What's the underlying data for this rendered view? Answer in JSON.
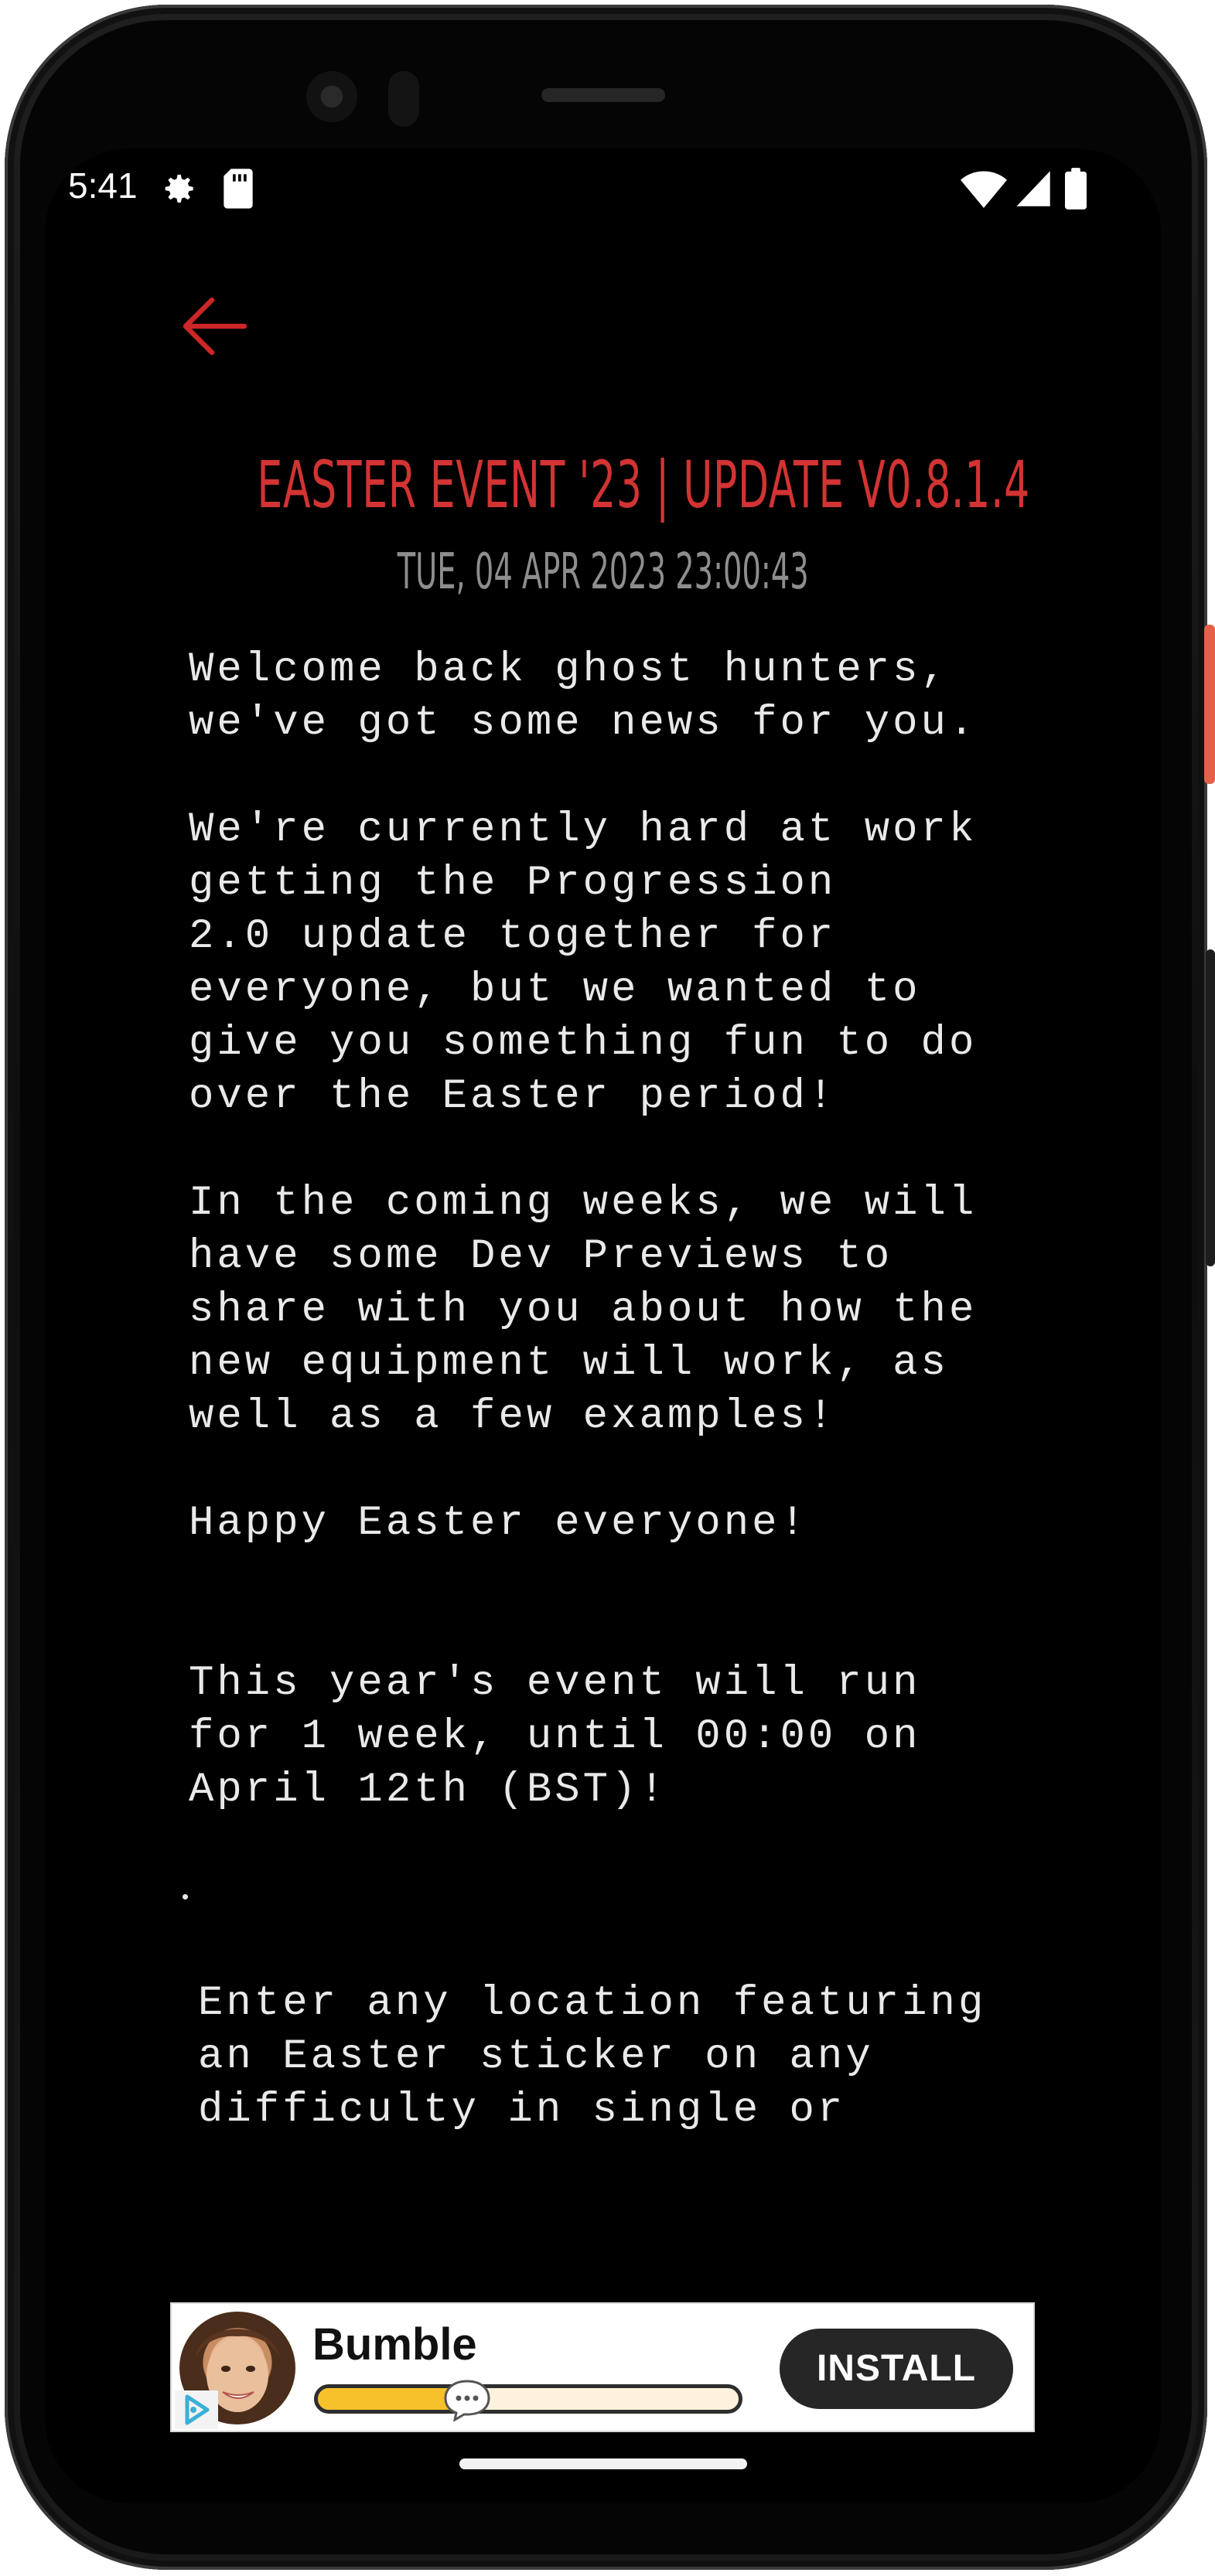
{
  "status_bar": {
    "time": "5:41",
    "icons": [
      "settings-gear-icon",
      "sd-card-icon",
      "wifi-icon",
      "cell-signal-icon",
      "battery-icon"
    ]
  },
  "header": {
    "back_icon": "arrow-left-icon",
    "title": "EASTER EVENT '23 | UPDATE V0.8.1.4",
    "date": "TUE, 04 APR 2023 23:00:43"
  },
  "article": {
    "paragraphs": [
      "Welcome back ghost hunters,\nwe've got some news for you.",
      "We're currently hard at work\ngetting the Progression\n2.0 update together for\neveryone, but we wanted to\ngive you something fun to do\nover the Easter period!",
      "In the coming weeks, we will\nhave some Dev Previews to\nshare with you about how the\nnew equipment will work, as\nwell as a few examples!",
      "Happy Easter everyone!",
      "This year's event will run\nfor 1 week, until 00:00 on\nApril 12th (BST)!"
    ],
    "bullet": "Enter any location featuring\nan Easter sticker on any\ndifficulty in single or"
  },
  "ad": {
    "app_name": "Bumble",
    "install_label": "INSTALL",
    "progress": 0.31,
    "icons": [
      "ad-choices-icon",
      "chat-bubble-icon"
    ]
  },
  "colors": {
    "accent_red": "#d23333",
    "date_gray": "#8e8e8e",
    "body_text": "#e9e9e9",
    "background": "#000000",
    "ad_progress_yellow": "#f6c12a"
  }
}
